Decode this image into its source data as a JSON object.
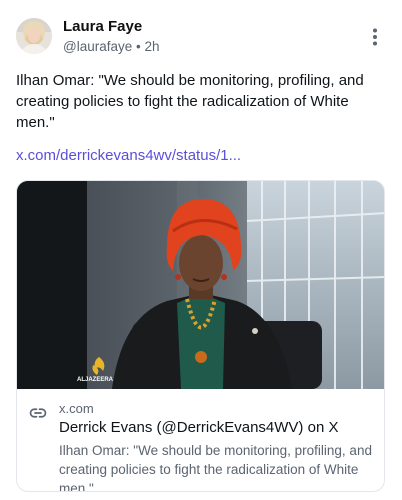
{
  "author": {
    "display_name": "Laura Faye",
    "handle": "@laurafaye",
    "separator": "•",
    "time": "2h"
  },
  "post": {
    "text": "Ilhan Omar: \"We should be monitoring, profiling, and creating policies to fight the radicalization of White men.\"",
    "link_text": "x.com/derrickevans4wv/status/1..."
  },
  "link_card": {
    "domain": "x.com",
    "title": "Derrick Evans (@DerrickEvans4WV) on X",
    "description": "Ilhan Omar: \"We should be monitoring, profiling, and creating policies to fight the radicalization of White men.\"",
    "watermark": "ALJAZEERA"
  },
  "icons": {
    "more": "more-vertical-icon",
    "link": "link-icon"
  },
  "colors": {
    "link": "#5b4fd9",
    "secondary_text": "#5b6470",
    "card_border": "#e3e6ea"
  }
}
